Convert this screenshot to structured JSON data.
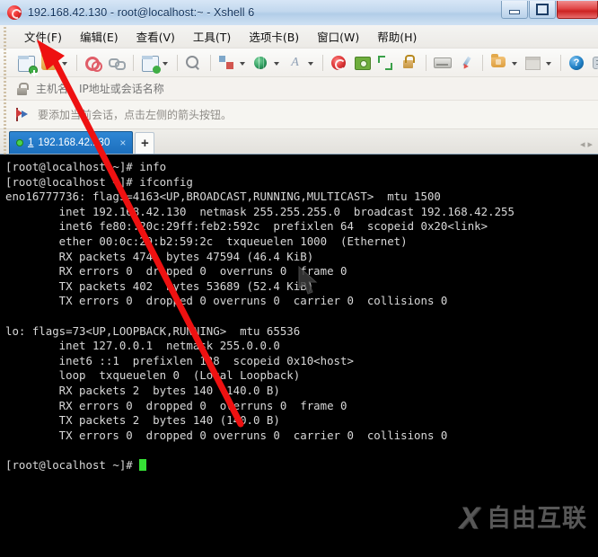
{
  "window": {
    "title": "192.168.42.130 - root@localhost:~ - Xshell 6",
    "icon": "xshell-logo-icon",
    "controls": {
      "minimize": "–",
      "maximize": "❑",
      "close": "✕"
    }
  },
  "menubar": {
    "items": [
      {
        "label": "文件(F)",
        "name": "menu-file"
      },
      {
        "label": "编辑(E)",
        "name": "menu-edit"
      },
      {
        "label": "查看(V)",
        "name": "menu-view"
      },
      {
        "label": "工具(T)",
        "name": "menu-tools"
      },
      {
        "label": "选项卡(B)",
        "name": "menu-tabs"
      },
      {
        "label": "窗口(W)",
        "name": "menu-window"
      },
      {
        "label": "帮助(H)",
        "name": "menu-help"
      }
    ]
  },
  "toolbar": {
    "icons": [
      "new-session-icon",
      "open-folder-icon",
      "session-manager-icon",
      "link-icon",
      "file-transfer-icon",
      "search-icon",
      "layout-icon",
      "globe-icon",
      "font-icon",
      "xshell-icon",
      "capture-icon",
      "fullscreen-icon",
      "lock-icon",
      "keyboard-icon",
      "highlight-pen-icon",
      "open-file-icon",
      "panel-icon",
      "help-icon",
      "chat-icon"
    ]
  },
  "address_bar": {
    "icon": "lock-icon",
    "placeholder": "主机名、IP地址或会话名称",
    "value": ""
  },
  "notice_bar": {
    "icon": "flag-icon",
    "text": "要添加当前会话，点击左侧的箭头按钮。"
  },
  "tabbar": {
    "tabs": [
      {
        "number": "1",
        "label": "192.168.42.130",
        "status": "connected",
        "close": "×",
        "active": true
      }
    ],
    "add_tab_label": "+",
    "nav_prev": "◂",
    "nav_next": "▸"
  },
  "terminal": {
    "prompt_user": "root",
    "prompt_host": "localhost",
    "cursor_color": "#35e035",
    "foreground": "#d8d8d8",
    "background": "#000000",
    "lines": [
      "[root@localhost ~]# info",
      "[root@localhost ~]# ifconfig",
      "eno16777736: flags=4163<UP,BROADCAST,RUNNING,MULTICAST>  mtu 1500",
      "        inet 192.168.42.130  netmask 255.255.255.0  broadcast 192.168.42.255",
      "        inet6 fe80::20c:29ff:feb2:592c  prefixlen 64  scopeid 0x20<link>",
      "        ether 00:0c:29:b2:59:2c  txqueuelen 1000  (Ethernet)",
      "        RX packets 474  bytes 47594 (46.4 KiB)",
      "        RX errors 0  dropped 0  overruns 0  frame 0",
      "        TX packets 402  bytes 53689 (52.4 KiB)",
      "        TX errors 0  dropped 0 overruns 0  carrier 0  collisions 0",
      "",
      "lo: flags=73<UP,LOOPBACK,RUNNING>  mtu 65536",
      "        inet 127.0.0.1  netmask 255.0.0.0",
      "        inet6 ::1  prefixlen 128  scopeid 0x10<host>",
      "        loop  txqueuelen 0  (Local Loopback)",
      "        RX packets 2  bytes 140 (140.0 B)",
      "        RX errors 0  dropped 0  overruns 0  frame 0",
      "        TX packets 2  bytes 140 (140.0 B)",
      "        TX errors 0  dropped 0 overruns 0  carrier 0  collisions 0",
      "",
      "[root@localhost ~]# "
    ]
  },
  "annotation": {
    "type": "red-arrow",
    "color": "#ee1111",
    "points_to": "menu-file"
  },
  "watermark": {
    "logo": "X",
    "text": "自由互联",
    "color": "#8d8d8d"
  }
}
